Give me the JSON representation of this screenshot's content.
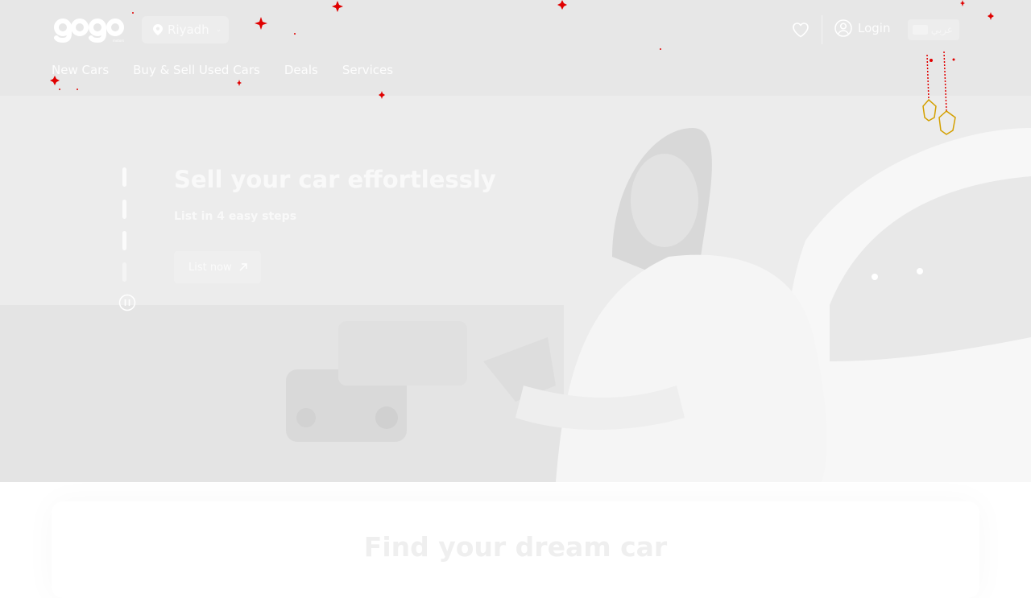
{
  "header": {
    "logo_text": "gogo",
    "city": {
      "label": "Riyadh"
    },
    "nav": [
      {
        "label": "New Cars"
      },
      {
        "label": "Buy & Sell Used Cars"
      },
      {
        "label": "Deals"
      },
      {
        "label": "Services"
      }
    ],
    "login_label": "Login",
    "language_label": "عربي"
  },
  "hero": {
    "title": "Sell your car effortlessly",
    "subtitle": "List in 4 easy steps",
    "cta_label": "List now",
    "slide_count": 4,
    "active_slide": 1
  },
  "search": {
    "title": "Find your dream car"
  },
  "colors": {
    "header_bg": "#e7e7e7",
    "decor_accent": "#e00000",
    "decor_lantern": "#f2c000"
  },
  "icons": {
    "city": "location-pin-icon",
    "city_toggle": "chevron-down-icon",
    "favorites": "heart-icon",
    "login": "user-circle-icon",
    "language": "flag-icon",
    "cta": "arrow-up-right-icon",
    "pause": "pause-icon"
  }
}
